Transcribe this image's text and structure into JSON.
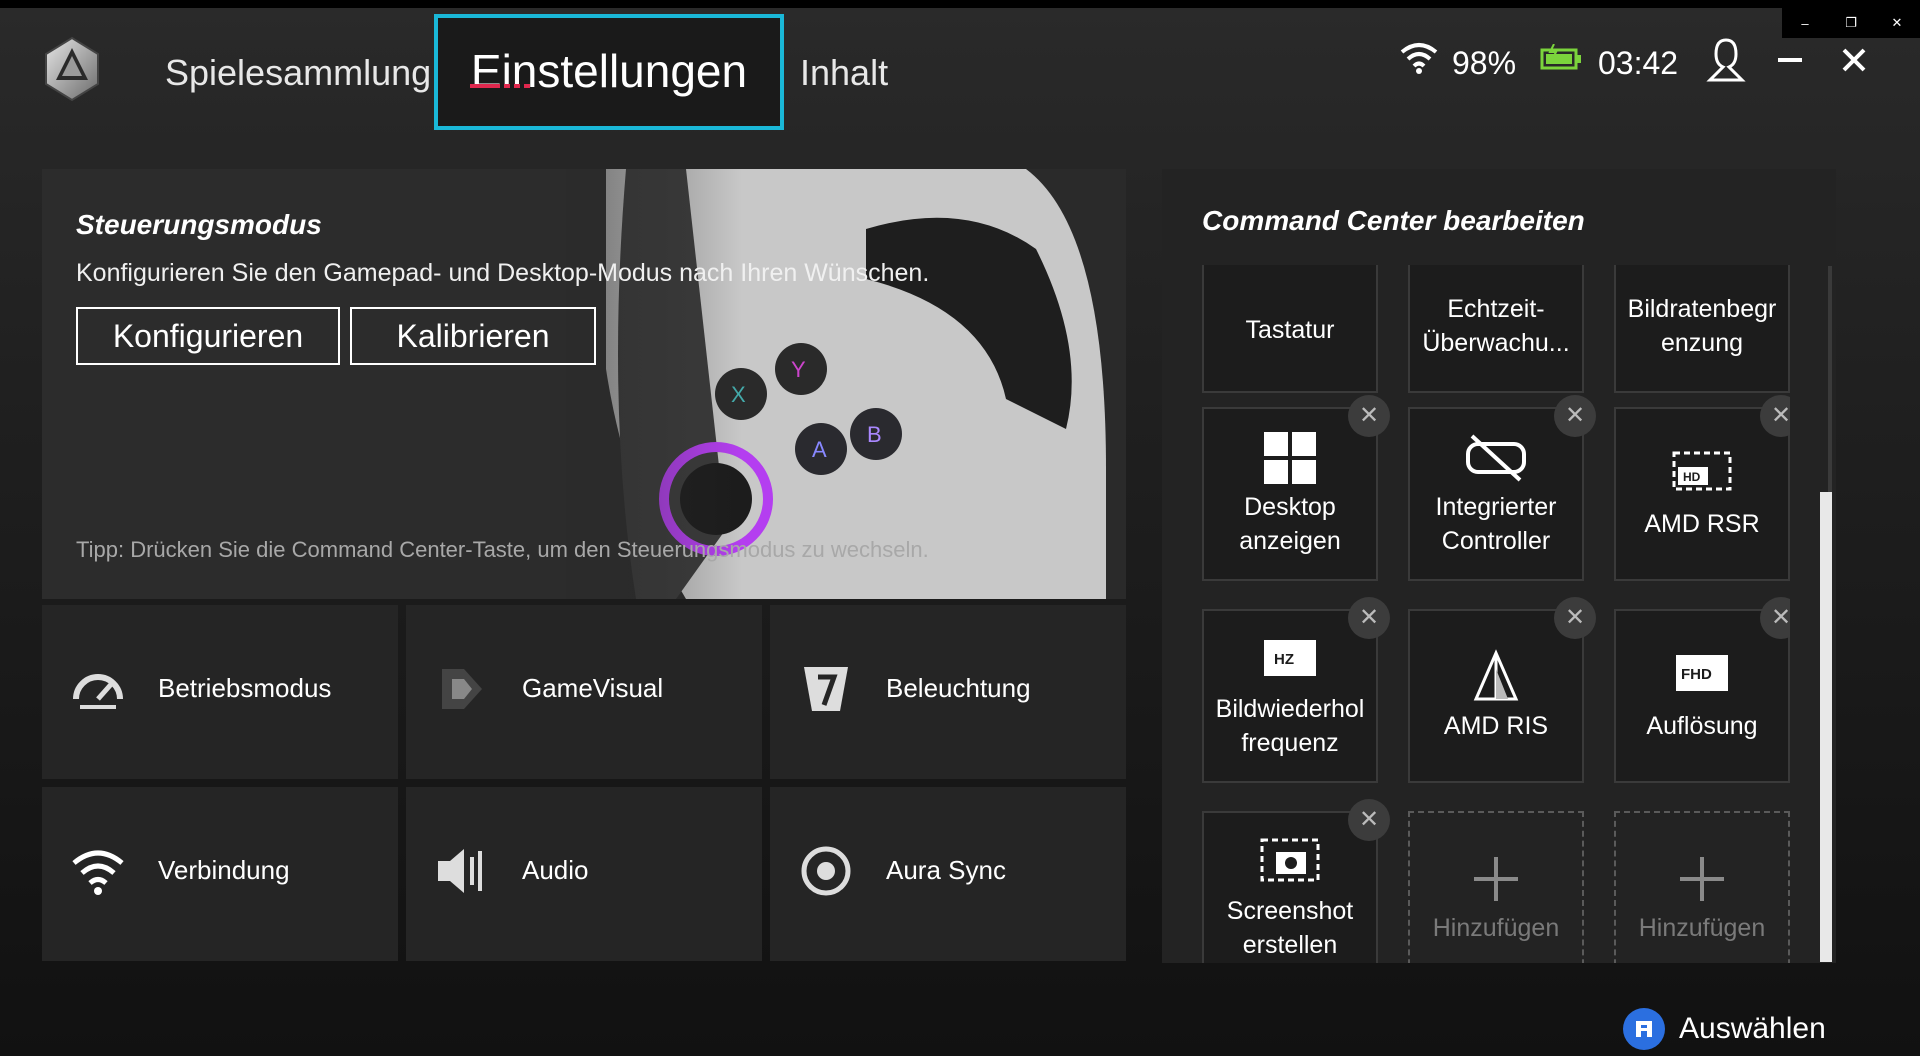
{
  "window": {
    "minimize_label": "–",
    "restore_label": "❐",
    "close_label": "✕"
  },
  "nav": {
    "tabs": [
      {
        "label": "Spielesammlung"
      },
      {
        "label": "Einstellungen",
        "active": true
      },
      {
        "label": "Inhalt"
      }
    ]
  },
  "status": {
    "battery": "98%",
    "time": "03:42"
  },
  "control_mode": {
    "title": "Steuerungsmodus",
    "description": "Konfigurieren Sie den Gamepad- und Desktop-Modus nach Ihren Wünschen.",
    "configure_label": "Konfigurieren",
    "calibrate_label": "Kalibrieren",
    "tip": "Tipp: Drücken Sie die Command Center-Taste, um den Steuerungsmodus zu wechseln."
  },
  "settings_tiles": [
    {
      "label": "Betriebsmodus",
      "icon": "operating-mode-icon"
    },
    {
      "label": "GameVisual",
      "icon": "gamevisual-icon"
    },
    {
      "label": "Beleuchtung",
      "icon": "lighting-icon"
    },
    {
      "label": "Verbindung",
      "icon": "wifi-icon"
    },
    {
      "label": "Audio",
      "icon": "audio-icon"
    },
    {
      "label": "Aura Sync",
      "icon": "aura-sync-icon"
    }
  ],
  "command_center": {
    "title": "Command Center bearbeiten",
    "tiles": [
      {
        "label": "Tastatur",
        "partial": true
      },
      {
        "label": "Echtzeit-\nÜberwachu...",
        "partial": true
      },
      {
        "label": "Bildratenbegr\nenzung",
        "partial": true
      },
      {
        "label": "Desktop\nanzeigen",
        "icon": "windows-icon",
        "removable": true
      },
      {
        "label": "Integrierter\nController",
        "icon": "controller-disabled-icon",
        "removable": true
      },
      {
        "label": "AMD RSR",
        "icon": "hd-icon",
        "removable": true
      },
      {
        "label": "Bildwiederhol\nfrequenz",
        "icon": "hz-icon",
        "removable": true
      },
      {
        "label": "AMD RIS",
        "icon": "sharpen-icon",
        "removable": true
      },
      {
        "label": "Auflösung",
        "icon": "fhd-icon",
        "removable": true
      },
      {
        "label": "Screenshot\nerstellen",
        "icon": "camera-icon",
        "removable": true
      },
      {
        "label": "Hinzufügen",
        "add": true
      },
      {
        "label": "Hinzufügen",
        "add": true
      }
    ],
    "remove_label": "✕"
  },
  "footer": {
    "hint_label": "Auswählen"
  },
  "colors": {
    "accent": "#1ab8d8",
    "select_button": "#2b6fe0"
  }
}
